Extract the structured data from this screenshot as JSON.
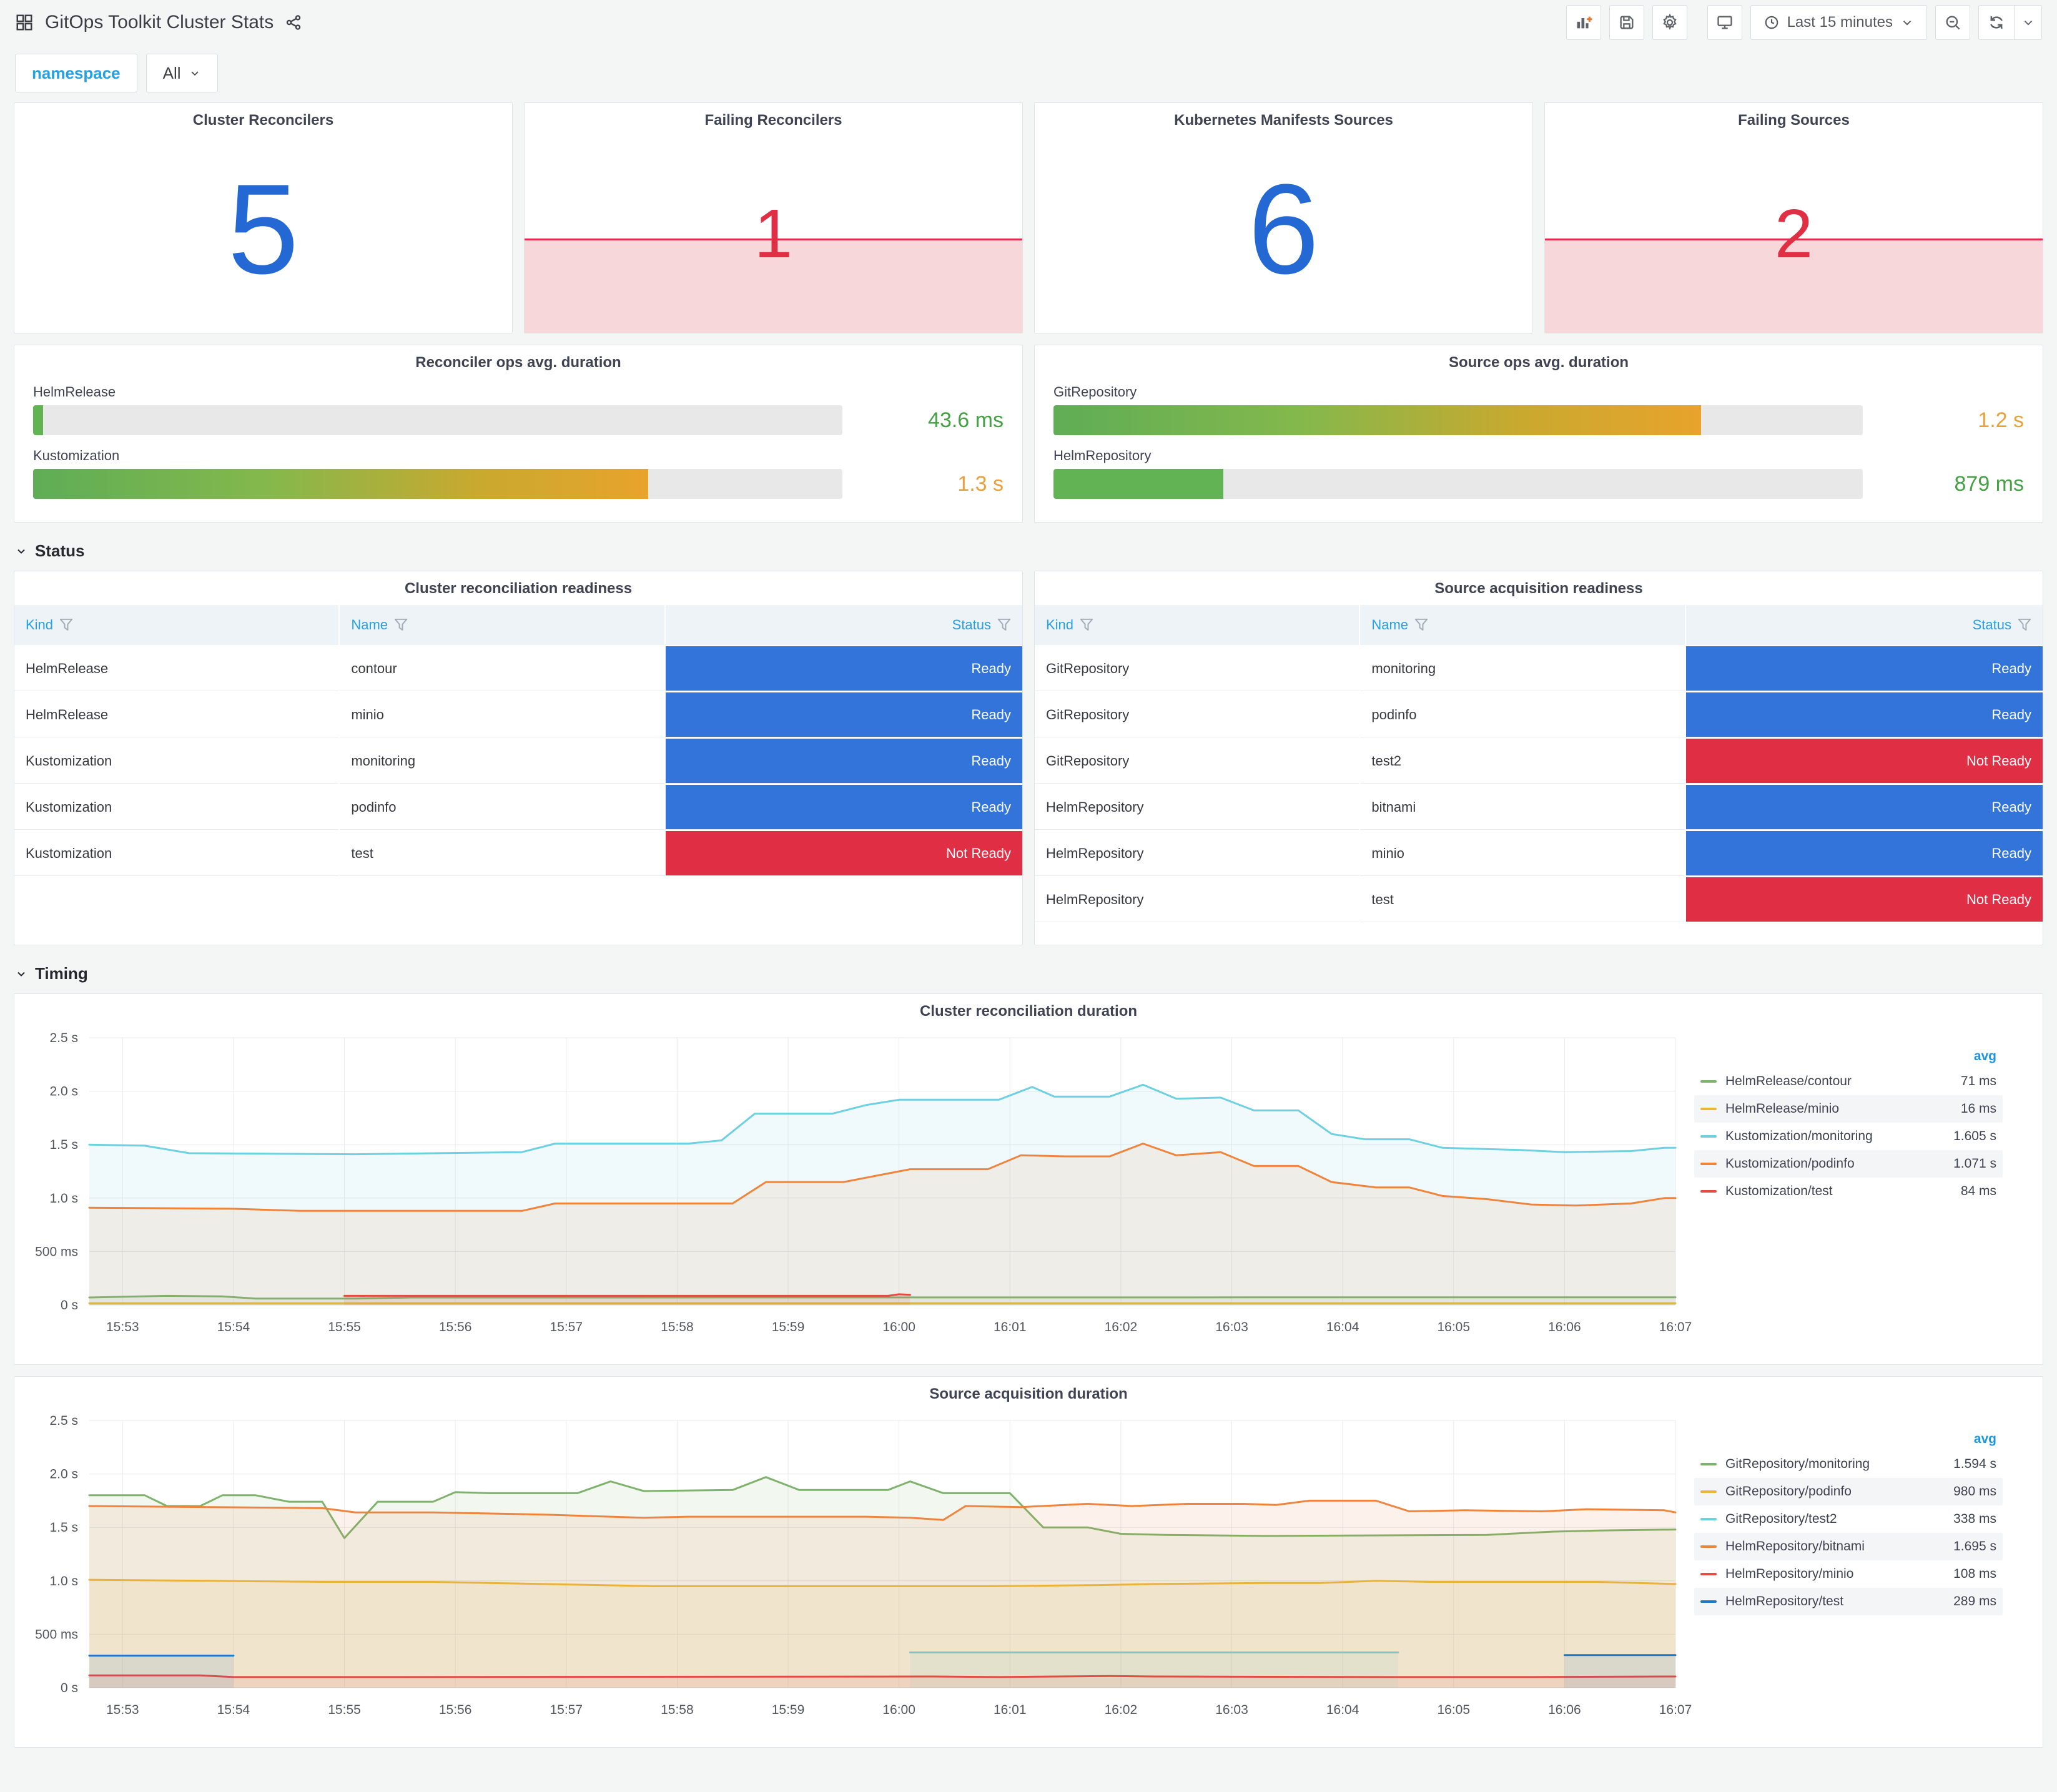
{
  "header": {
    "title": "GitOps Toolkit Cluster Stats",
    "time_range": "Last 15 minutes"
  },
  "filters": {
    "namespace_label": "namespace",
    "namespace_value": "All"
  },
  "sections": {
    "status": "Status",
    "timing": "Timing"
  },
  "colors": {
    "stat_ok": "#2469d3",
    "stat_alert": "#e02f44",
    "alert_fill": "#f8d7db",
    "ready_bg": "#3274d9",
    "not_ready_bg": "#e02f44",
    "link_blue": "#23a1e4",
    "gauge_green_text": "#46a146",
    "gauge_orange_text": "#e7a23c"
  },
  "stats": [
    {
      "title": "Cluster Reconcilers",
      "value": "5",
      "state": "ok"
    },
    {
      "title": "Failing Reconcilers",
      "value": "1",
      "state": "alert"
    },
    {
      "title": "Kubernetes Manifests Sources",
      "value": "6",
      "state": "ok"
    },
    {
      "title": "Failing Sources",
      "value": "2",
      "state": "alert"
    }
  ],
  "gauges": [
    {
      "title": "Reconciler ops avg. duration",
      "rows": [
        {
          "label": "HelmRelease",
          "value": "43.6 ms",
          "value_color": "#46a146",
          "percent": 1.2,
          "fill": "green"
        },
        {
          "label": "Kustomization",
          "value": "1.3 s",
          "value_color": "#e7a23c",
          "percent": 76,
          "fill": "gradient"
        }
      ]
    },
    {
      "title": "Source ops avg. duration",
      "rows": [
        {
          "label": "GitRepository",
          "value": "1.2 s",
          "value_color": "#e7a23c",
          "percent": 80,
          "fill": "gradient"
        },
        {
          "label": "HelmRepository",
          "value": "879 ms",
          "value_color": "#46a146",
          "percent": 21,
          "fill": "green"
        }
      ]
    }
  ],
  "tables": [
    {
      "title": "Cluster reconciliation readiness",
      "columns": [
        "Kind",
        "Name",
        "Status"
      ],
      "rows": [
        [
          "HelmRelease",
          "contour",
          "Ready"
        ],
        [
          "HelmRelease",
          "minio",
          "Ready"
        ],
        [
          "Kustomization",
          "monitoring",
          "Ready"
        ],
        [
          "Kustomization",
          "podinfo",
          "Ready"
        ],
        [
          "Kustomization",
          "test",
          "Not Ready"
        ]
      ]
    },
    {
      "title": "Source acquisition readiness",
      "columns": [
        "Kind",
        "Name",
        "Status"
      ],
      "rows": [
        [
          "GitRepository",
          "monitoring",
          "Ready"
        ],
        [
          "GitRepository",
          "podinfo",
          "Ready"
        ],
        [
          "GitRepository",
          "test2",
          "Not Ready"
        ],
        [
          "HelmRepository",
          "bitnami",
          "Ready"
        ],
        [
          "HelmRepository",
          "minio",
          "Ready"
        ],
        [
          "HelmRepository",
          "test",
          "Not Ready"
        ]
      ]
    }
  ],
  "chart_data": [
    {
      "type": "line",
      "title": "Cluster reconciliation duration",
      "ylabel": "duration",
      "y_max": 2.5,
      "grid": true,
      "legend_position": "right",
      "legend_value_header": "avg",
      "y_ticks": [
        {
          "v": 0,
          "label": "0 s"
        },
        {
          "v": 0.5,
          "label": "500 ms"
        },
        {
          "v": 1,
          "label": "1.0 s"
        },
        {
          "v": 1.5,
          "label": "1.5 s"
        },
        {
          "v": 2,
          "label": "2.0 s"
        },
        {
          "v": 2.5,
          "label": "2.5 s"
        }
      ],
      "x_domain_minutes": [
        52.7,
        67.0
      ],
      "x_tick_labels": [
        "15:53",
        "15:54",
        "15:55",
        "15:56",
        "15:57",
        "15:58",
        "15:59",
        "16:00",
        "16:01",
        "16:02",
        "16:03",
        "16:04",
        "16:05",
        "16:06",
        "16:07"
      ],
      "x_tick_first_minute": 53,
      "series": [
        {
          "name": "HelmRelease/contour",
          "color": "#7EB26D",
          "avg": "71 ms",
          "segments": [
            [
              [
                52.7,
                0.07
              ],
              [
                53.4,
                0.085
              ],
              [
                53.9,
                0.08
              ],
              [
                54.2,
                0.06
              ],
              [
                55.1,
                0.06
              ],
              [
                55.6,
                0.07
              ],
              [
                67.0,
                0.072
              ]
            ]
          ]
        },
        {
          "name": "HelmRelease/minio",
          "color": "#EAB839",
          "avg": "16 ms",
          "segments": [
            [
              [
                52.7,
                0.016
              ],
              [
                67.0,
                0.016
              ]
            ]
          ]
        },
        {
          "name": "Kustomization/monitoring",
          "color": "#6ED0E0",
          "avg": "1.605 s",
          "segments": [
            [
              [
                52.7,
                1.5
              ],
              [
                53.2,
                1.49
              ],
              [
                53.6,
                1.42
              ],
              [
                55.1,
                1.41
              ],
              [
                56.6,
                1.43
              ],
              [
                56.9,
                1.51
              ],
              [
                58.1,
                1.51
              ],
              [
                58.4,
                1.54
              ],
              [
                58.7,
                1.79
              ],
              [
                59.4,
                1.79
              ],
              [
                59.7,
                1.87
              ],
              [
                60.0,
                1.92
              ],
              [
                60.9,
                1.92
              ],
              [
                61.2,
                2.04
              ],
              [
                61.4,
                1.95
              ],
              [
                61.9,
                1.95
              ],
              [
                62.2,
                2.06
              ],
              [
                62.5,
                1.93
              ],
              [
                62.9,
                1.94
              ],
              [
                63.2,
                1.82
              ],
              [
                63.6,
                1.82
              ],
              [
                63.9,
                1.6
              ],
              [
                64.2,
                1.55
              ],
              [
                64.6,
                1.55
              ],
              [
                64.9,
                1.47
              ],
              [
                65.6,
                1.45
              ],
              [
                66.0,
                1.43
              ],
              [
                66.6,
                1.44
              ],
              [
                66.9,
                1.47
              ],
              [
                67.0,
                1.47
              ]
            ]
          ]
        },
        {
          "name": "Kustomization/podinfo",
          "color": "#EF843C",
          "avg": "1.071 s",
          "segments": [
            [
              [
                52.7,
                0.91
              ],
              [
                54.0,
                0.9
              ],
              [
                54.6,
                0.88
              ],
              [
                56.6,
                0.88
              ],
              [
                56.9,
                0.95
              ],
              [
                58.5,
                0.95
              ],
              [
                58.8,
                1.15
              ],
              [
                59.5,
                1.15
              ],
              [
                59.9,
                1.23
              ],
              [
                60.1,
                1.27
              ],
              [
                60.8,
                1.27
              ],
              [
                61.1,
                1.4
              ],
              [
                61.5,
                1.39
              ],
              [
                61.9,
                1.39
              ],
              [
                62.2,
                1.51
              ],
              [
                62.5,
                1.4
              ],
              [
                62.9,
                1.43
              ],
              [
                63.2,
                1.3
              ],
              [
                63.6,
                1.3
              ],
              [
                63.9,
                1.15
              ],
              [
                64.3,
                1.1
              ],
              [
                64.6,
                1.1
              ],
              [
                64.9,
                1.02
              ],
              [
                65.3,
                0.99
              ],
              [
                65.7,
                0.94
              ],
              [
                66.1,
                0.93
              ],
              [
                66.6,
                0.95
              ],
              [
                66.9,
                1.0
              ],
              [
                67.0,
                1.0
              ]
            ]
          ]
        },
        {
          "name": "Kustomization/test",
          "color": "#E24D42",
          "avg": "84 ms",
          "segments": [
            [
              [
                55.0,
                0.085
              ],
              [
                59.9,
                0.085
              ],
              [
                60.0,
                0.1
              ],
              [
                60.1,
                0.095
              ]
            ]
          ]
        }
      ]
    },
    {
      "type": "line",
      "title": "Source acquisition duration",
      "ylabel": "duration",
      "y_max": 2.5,
      "grid": true,
      "legend_position": "right",
      "legend_value_header": "avg",
      "y_ticks": [
        {
          "v": 0,
          "label": "0 s"
        },
        {
          "v": 0.5,
          "label": "500 ms"
        },
        {
          "v": 1,
          "label": "1.0 s"
        },
        {
          "v": 1.5,
          "label": "1.5 s"
        },
        {
          "v": 2,
          "label": "2.0 s"
        },
        {
          "v": 2.5,
          "label": "2.5 s"
        }
      ],
      "x_domain_minutes": [
        52.7,
        67.0
      ],
      "x_tick_labels": [
        "15:53",
        "15:54",
        "15:55",
        "15:56",
        "15:57",
        "15:58",
        "15:59",
        "16:00",
        "16:01",
        "16:02",
        "16:03",
        "16:04",
        "16:05",
        "16:06",
        "16:07"
      ],
      "x_tick_first_minute": 53,
      "series": [
        {
          "name": "GitRepository/monitoring",
          "color": "#7EB26D",
          "avg": "1.594 s",
          "segments": [
            [
              [
                52.7,
                1.8
              ],
              [
                53.2,
                1.8
              ],
              [
                53.4,
                1.7
              ],
              [
                53.7,
                1.7
              ],
              [
                53.9,
                1.8
              ],
              [
                54.2,
                1.8
              ],
              [
                54.5,
                1.74
              ],
              [
                54.8,
                1.74
              ],
              [
                55.0,
                1.4
              ],
              [
                55.3,
                1.74
              ],
              [
                55.8,
                1.74
              ],
              [
                56.0,
                1.83
              ],
              [
                56.3,
                1.82
              ],
              [
                57.1,
                1.82
              ],
              [
                57.4,
                1.93
              ],
              [
                57.7,
                1.84
              ],
              [
                58.5,
                1.85
              ],
              [
                58.8,
                1.97
              ],
              [
                59.1,
                1.85
              ],
              [
                59.9,
                1.85
              ],
              [
                60.1,
                1.93
              ],
              [
                60.4,
                1.82
              ],
              [
                61.0,
                1.82
              ],
              [
                61.3,
                1.5
              ],
              [
                61.7,
                1.5
              ],
              [
                62.0,
                1.44
              ],
              [
                62.4,
                1.43
              ],
              [
                63.3,
                1.42
              ],
              [
                65.3,
                1.43
              ],
              [
                65.9,
                1.46
              ],
              [
                66.3,
                1.47
              ],
              [
                67.0,
                1.48
              ]
            ]
          ]
        },
        {
          "name": "GitRepository/podinfo",
          "color": "#EAB839",
          "avg": "980 ms",
          "segments": [
            [
              [
                52.7,
                1.01
              ],
              [
                53.8,
                1.0
              ],
              [
                54.8,
                0.99
              ],
              [
                55.8,
                0.99
              ],
              [
                56.3,
                0.98
              ],
              [
                56.8,
                0.97
              ],
              [
                57.3,
                0.96
              ],
              [
                57.8,
                0.95
              ],
              [
                59.8,
                0.95
              ],
              [
                60.8,
                0.95
              ],
              [
                61.8,
                0.96
              ],
              [
                62.3,
                0.97
              ],
              [
                63.3,
                0.98
              ],
              [
                63.8,
                0.98
              ],
              [
                64.3,
                1.0
              ],
              [
                64.8,
                0.99
              ],
              [
                66.3,
                0.99
              ],
              [
                67.0,
                0.97
              ]
            ]
          ]
        },
        {
          "name": "GitRepository/test2",
          "color": "#6ED0E0",
          "avg": "338 ms",
          "segments": [
            [
              [
                60.1,
                0.33
              ],
              [
                64.5,
                0.33
              ]
            ]
          ]
        },
        {
          "name": "HelmRepository/bitnami",
          "color": "#EF843C",
          "avg": "1.695 s",
          "segments": [
            [
              [
                52.7,
                1.7
              ],
              [
                53.8,
                1.69
              ],
              [
                54.8,
                1.68
              ],
              [
                55.1,
                1.64
              ],
              [
                55.8,
                1.64
              ],
              [
                56.8,
                1.62
              ],
              [
                57.7,
                1.59
              ],
              [
                58.1,
                1.6
              ],
              [
                59.7,
                1.6
              ],
              [
                60.1,
                1.59
              ],
              [
                60.4,
                1.57
              ],
              [
                60.6,
                1.7
              ],
              [
                61.1,
                1.69
              ],
              [
                61.7,
                1.72
              ],
              [
                62.1,
                1.7
              ],
              [
                62.6,
                1.72
              ],
              [
                63.1,
                1.72
              ],
              [
                63.4,
                1.71
              ],
              [
                63.7,
                1.75
              ],
              [
                64.3,
                1.75
              ],
              [
                64.6,
                1.65
              ],
              [
                65.1,
                1.66
              ],
              [
                65.8,
                1.65
              ],
              [
                66.2,
                1.67
              ],
              [
                66.9,
                1.66
              ],
              [
                67.0,
                1.64
              ]
            ]
          ]
        },
        {
          "name": "HelmRepository/minio",
          "color": "#E24D42",
          "avg": "108 ms",
          "segments": [
            [
              [
                52.7,
                0.115
              ],
              [
                53.7,
                0.115
              ],
              [
                54.0,
                0.1
              ],
              [
                55.0,
                0.1
              ],
              [
                60.3,
                0.105
              ],
              [
                60.9,
                0.1
              ],
              [
                61.9,
                0.11
              ],
              [
                62.3,
                0.105
              ],
              [
                64.4,
                0.1
              ],
              [
                65.7,
                0.1
              ],
              [
                67.0,
                0.105
              ]
            ]
          ]
        },
        {
          "name": "HelmRepository/test",
          "color": "#1F78C1",
          "avg": "289 ms",
          "segments": [
            [
              [
                52.7,
                0.3
              ],
              [
                54.0,
                0.3
              ]
            ],
            [
              [
                66.0,
                0.305
              ],
              [
                67.0,
                0.305
              ]
            ]
          ]
        }
      ]
    }
  ]
}
